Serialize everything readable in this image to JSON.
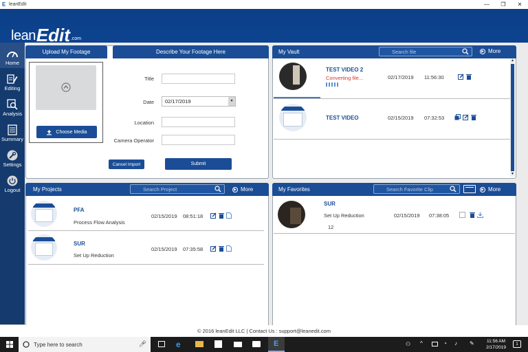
{
  "window": {
    "title": "leanEdit",
    "minimize": "—",
    "restore": "❐",
    "close": "✕"
  },
  "logo": {
    "lean": "lean",
    "edit": "Edit",
    "com": ".com"
  },
  "sidebar": {
    "items": [
      {
        "label": "Home",
        "icon": "speedometer-icon",
        "active": true
      },
      {
        "label": "Editing",
        "icon": "edit-icon"
      },
      {
        "label": "Analysis",
        "icon": "analysis-icon"
      },
      {
        "label": "Summary",
        "icon": "summary-icon"
      },
      {
        "label": "Settings",
        "icon": "wrench-icon"
      },
      {
        "label": "Logout",
        "icon": "power-icon"
      }
    ]
  },
  "upload": {
    "tab_upload": "Upload My Footage",
    "tab_describe": "Describe Your Footage Here",
    "choose_media": "Choose Media",
    "title_label": "Title",
    "title_value": "",
    "date_label": "Date",
    "date_value": "02/17/2019",
    "location_label": "Location",
    "location_value": "",
    "operator_label": "Camera Operator",
    "operator_value": "",
    "cancel_label": "Cancel Import",
    "submit_label": "Submit"
  },
  "vault": {
    "title": "My Vault",
    "search_placeholder": "Search file",
    "more_label": "More",
    "items": [
      {
        "title": "TEST VIDEO 2",
        "status": "Converting file...",
        "date": "02/17/2019",
        "time": "11:56:30",
        "progress": 0.45
      },
      {
        "title": "TEST VIDEO",
        "status": "",
        "date": "02/15/2019",
        "time": "07:32:53"
      }
    ]
  },
  "projects": {
    "title": "My Projects",
    "search_placeholder": "Search Project",
    "more_label": "More",
    "items": [
      {
        "code": "PFA",
        "name": "Process Flow Analysis",
        "date": "02/15/2019",
        "time": "08:51:18"
      },
      {
        "code": "SUR",
        "name": "Set Up Reduction",
        "date": "02/15/2019",
        "time": "07:35:58"
      }
    ]
  },
  "favorites": {
    "title": "My Favorites",
    "search_placeholder": "Search Favorite Clip",
    "more_label": "More",
    "items": [
      {
        "code": "SUR",
        "name": "Set Up Reduction",
        "count": "12",
        "date": "02/15/2019",
        "time": "07:38:05"
      }
    ]
  },
  "footer": {
    "text": "© 2016 leanEdit LLC | Contact Us : support@leanedit.com"
  },
  "taskbar": {
    "search_placeholder": "Type here to search",
    "time": "11:56 AM",
    "date": "2/17/2019"
  },
  "colors": {
    "header": "#0d4390",
    "sidebar": "#143a6e",
    "accent": "#1b4d96",
    "status_red": "#d9342b"
  }
}
